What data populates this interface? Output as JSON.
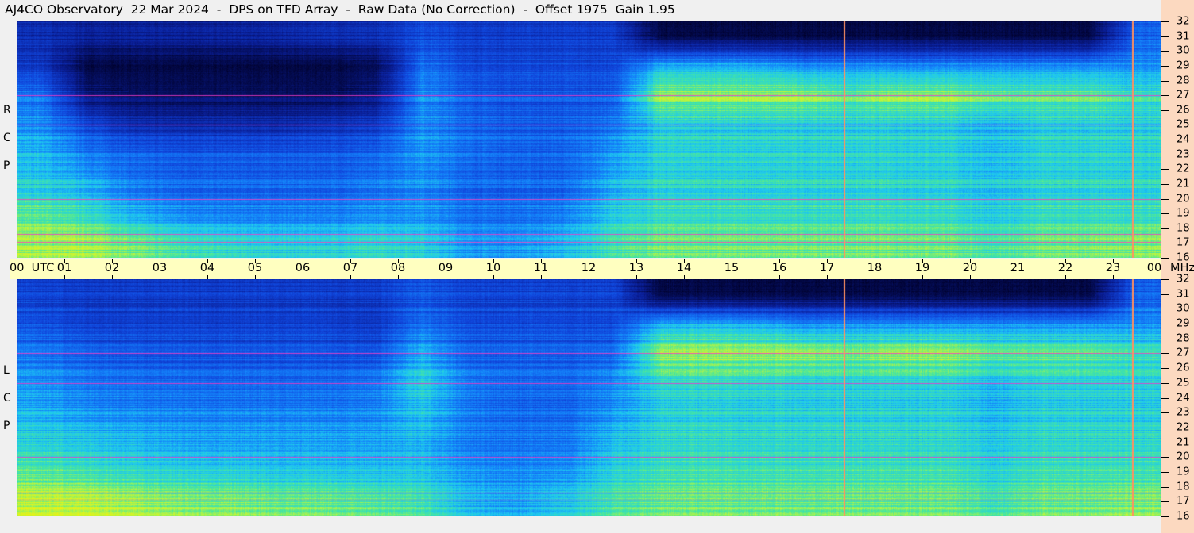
{
  "title": "AJ4CO Observatory  22 Mar 2024  -  DPS on TFD Array  -  Raw Data (No Correction)  -  Offset 1975  Gain 1.95",
  "chart_data": [
    {
      "type": "heatmap",
      "panel": "RCP",
      "side_label": [
        "R",
        "C",
        "P"
      ],
      "x_unit": "UTC",
      "y_unit": "MHz",
      "xlim": [
        0,
        24
      ],
      "ylim": [
        16,
        32
      ],
      "x_tick_labels": [
        "00",
        "01",
        "02",
        "03",
        "04",
        "05",
        "06",
        "07",
        "08",
        "09",
        "10",
        "11",
        "12",
        "13",
        "14",
        "15",
        "16",
        "17",
        "18",
        "19",
        "20",
        "21",
        "22",
        "23",
        "00"
      ],
      "y_tick_labels": [
        "16",
        "17",
        "18",
        "19",
        "20",
        "21",
        "22",
        "23",
        "24",
        "25",
        "26",
        "27",
        "28",
        "29",
        "30",
        "31",
        "32"
      ],
      "rows_mhz": [
        31,
        29,
        27,
        25,
        23,
        21,
        19,
        17
      ],
      "intensity": [
        [
          0.25,
          0.2,
          0.2,
          0.2,
          0.2,
          0.22,
          0.25,
          0.25,
          0.35,
          0.3,
          0.3,
          0.3,
          0.3,
          0.05,
          0.05,
          0.05,
          0.05,
          0.05,
          0.05,
          0.05,
          0.05,
          0.05,
          0.05,
          0.4
        ],
        [
          0.3,
          0.05,
          0.05,
          0.05,
          0.05,
          0.05,
          0.05,
          0.08,
          0.45,
          0.35,
          0.35,
          0.35,
          0.35,
          0.55,
          0.55,
          0.55,
          0.5,
          0.5,
          0.5,
          0.5,
          0.5,
          0.5,
          0.5,
          0.5
        ],
        [
          0.45,
          0.15,
          0.1,
          0.1,
          0.1,
          0.1,
          0.1,
          0.15,
          0.5,
          0.4,
          0.38,
          0.38,
          0.4,
          0.75,
          0.75,
          0.75,
          0.75,
          0.7,
          0.75,
          0.75,
          0.7,
          0.7,
          0.7,
          0.65
        ],
        [
          0.5,
          0.35,
          0.25,
          0.25,
          0.25,
          0.25,
          0.28,
          0.3,
          0.5,
          0.42,
          0.4,
          0.4,
          0.45,
          0.6,
          0.6,
          0.6,
          0.6,
          0.6,
          0.6,
          0.6,
          0.55,
          0.6,
          0.6,
          0.6
        ],
        [
          0.55,
          0.45,
          0.4,
          0.38,
          0.38,
          0.38,
          0.38,
          0.4,
          0.5,
          0.42,
          0.4,
          0.4,
          0.5,
          0.6,
          0.6,
          0.6,
          0.6,
          0.6,
          0.6,
          0.6,
          0.55,
          0.6,
          0.6,
          0.6
        ],
        [
          0.6,
          0.55,
          0.45,
          0.42,
          0.42,
          0.42,
          0.42,
          0.45,
          0.5,
          0.42,
          0.42,
          0.42,
          0.55,
          0.62,
          0.62,
          0.62,
          0.62,
          0.62,
          0.62,
          0.62,
          0.58,
          0.62,
          0.62,
          0.62
        ],
        [
          0.7,
          0.65,
          0.55,
          0.5,
          0.48,
          0.48,
          0.48,
          0.5,
          0.52,
          0.45,
          0.45,
          0.48,
          0.6,
          0.65,
          0.65,
          0.65,
          0.65,
          0.65,
          0.65,
          0.65,
          0.6,
          0.65,
          0.65,
          0.65
        ],
        [
          0.75,
          0.75,
          0.7,
          0.65,
          0.62,
          0.6,
          0.6,
          0.62,
          0.6,
          0.5,
          0.5,
          0.55,
          0.65,
          0.7,
          0.7,
          0.7,
          0.7,
          0.7,
          0.7,
          0.7,
          0.65,
          0.7,
          0.7,
          0.72
        ]
      ],
      "interference_mhz": [
        25.0,
        20.0,
        17.6,
        17.1,
        27.0
      ],
      "marker_times_utc": [
        17.35,
        23.4
      ]
    },
    {
      "type": "heatmap",
      "panel": "LCP",
      "side_label": [
        "L",
        "C",
        "P"
      ],
      "x_unit": "UTC",
      "y_unit": "MHz",
      "xlim": [
        0,
        24
      ],
      "ylim": [
        16,
        32
      ],
      "y_tick_labels": [
        "16",
        "17",
        "18",
        "19",
        "20",
        "21",
        "22",
        "23",
        "24",
        "25",
        "26",
        "27",
        "28",
        "29",
        "30",
        "31",
        "32"
      ],
      "rows_mhz": [
        31,
        29,
        27,
        25,
        23,
        21,
        19,
        17
      ],
      "intensity": [
        [
          0.32,
          0.3,
          0.3,
          0.3,
          0.3,
          0.3,
          0.3,
          0.3,
          0.38,
          0.32,
          0.32,
          0.32,
          0.32,
          0.05,
          0.05,
          0.05,
          0.05,
          0.05,
          0.05,
          0.05,
          0.05,
          0.05,
          0.05,
          0.4
        ],
        [
          0.38,
          0.33,
          0.33,
          0.33,
          0.33,
          0.33,
          0.33,
          0.3,
          0.45,
          0.36,
          0.36,
          0.36,
          0.36,
          0.55,
          0.55,
          0.55,
          0.5,
          0.5,
          0.5,
          0.5,
          0.5,
          0.5,
          0.5,
          0.5
        ],
        [
          0.45,
          0.4,
          0.38,
          0.37,
          0.37,
          0.37,
          0.37,
          0.36,
          0.55,
          0.4,
          0.4,
          0.4,
          0.42,
          0.75,
          0.75,
          0.75,
          0.75,
          0.72,
          0.75,
          0.75,
          0.7,
          0.7,
          0.7,
          0.65
        ],
        [
          0.5,
          0.45,
          0.43,
          0.42,
          0.42,
          0.42,
          0.42,
          0.45,
          0.62,
          0.45,
          0.42,
          0.42,
          0.48,
          0.62,
          0.62,
          0.62,
          0.6,
          0.6,
          0.6,
          0.6,
          0.55,
          0.6,
          0.6,
          0.6
        ],
        [
          0.55,
          0.5,
          0.48,
          0.47,
          0.47,
          0.47,
          0.47,
          0.48,
          0.58,
          0.45,
          0.42,
          0.42,
          0.5,
          0.6,
          0.6,
          0.6,
          0.6,
          0.6,
          0.6,
          0.6,
          0.55,
          0.6,
          0.6,
          0.6
        ],
        [
          0.6,
          0.58,
          0.55,
          0.52,
          0.52,
          0.52,
          0.52,
          0.52,
          0.55,
          0.45,
          0.44,
          0.45,
          0.56,
          0.62,
          0.62,
          0.62,
          0.62,
          0.62,
          0.62,
          0.62,
          0.58,
          0.62,
          0.62,
          0.62
        ],
        [
          0.68,
          0.65,
          0.62,
          0.6,
          0.6,
          0.58,
          0.58,
          0.57,
          0.58,
          0.5,
          0.48,
          0.5,
          0.6,
          0.65,
          0.65,
          0.65,
          0.65,
          0.65,
          0.65,
          0.65,
          0.6,
          0.65,
          0.65,
          0.65
        ],
        [
          0.78,
          0.78,
          0.75,
          0.72,
          0.72,
          0.7,
          0.7,
          0.68,
          0.66,
          0.55,
          0.52,
          0.58,
          0.66,
          0.7,
          0.7,
          0.7,
          0.7,
          0.7,
          0.7,
          0.7,
          0.65,
          0.7,
          0.7,
          0.72
        ]
      ],
      "interference_mhz": [
        25.0,
        20.0,
        17.6,
        17.1,
        27.0
      ],
      "marker_times_utc": [
        17.35,
        23.4
      ]
    }
  ],
  "x_axis": {
    "first_label": "00  UTC",
    "last_label": "00",
    "unit_label": "MHz"
  }
}
